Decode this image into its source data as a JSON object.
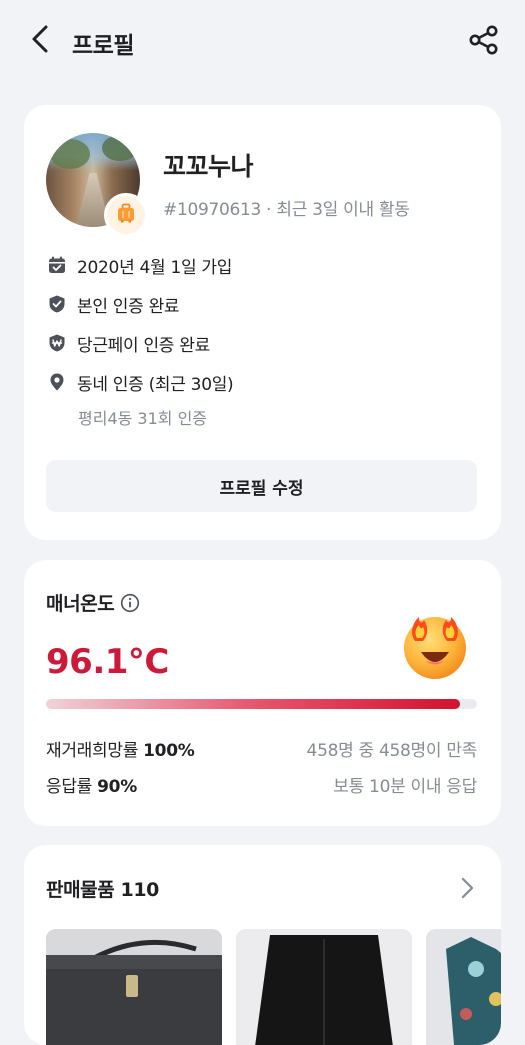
{
  "header": {
    "title": "프로필",
    "back_icon": "chevron-left-icon",
    "share_icon": "share-icon"
  },
  "profile": {
    "nickname": "꼬꼬누나",
    "subinfo": "#10970613 · 최근 3일 이내 활동",
    "badge_icon": "suitcase-icon",
    "rows": [
      {
        "icon": "calendar-icon",
        "label": "2020년 4월 1일 가입"
      },
      {
        "icon": "shield-check-icon",
        "label": "본인 인증 완료"
      },
      {
        "icon": "shield-won-icon",
        "label": "당근페이 인증 완료"
      },
      {
        "icon": "location-pin-icon",
        "label": "동네 인증 (최근 30일)"
      }
    ],
    "neighborhood_detail": "평리4동 31회 인증",
    "edit_button": "프로필 수정"
  },
  "manner": {
    "title": "매너온도",
    "temperature": "96.1°C",
    "temperature_fraction": 0.96,
    "emoji_icon": "fire-eyes-emoji-icon",
    "rehire_label": "재거래희망률",
    "rehire_value": "100%",
    "rehire_detail": "458명 중 458명이 만족",
    "response_label": "응답률",
    "response_value": "90%",
    "response_detail": "보통 10분 이내 응답"
  },
  "sales": {
    "title": "판매물품 110",
    "chevron_icon": "chevron-right-icon"
  },
  "colors": {
    "temperature": "#cc1a3a",
    "muted_text": "#868b94",
    "background": "#f2f3f6"
  }
}
